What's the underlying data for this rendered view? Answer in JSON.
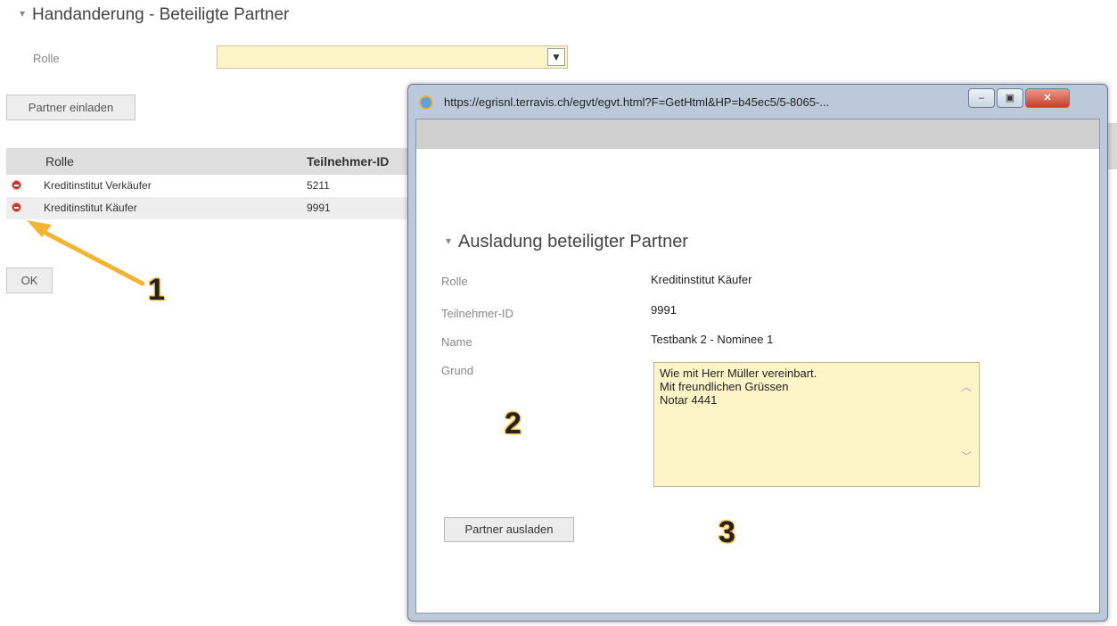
{
  "page": {
    "title": "Handanderung - Beteiligte Partner",
    "rolle_label": "Rolle",
    "rolle_value": "",
    "select_arrow_icon": "chevron-down-icon",
    "invite_button": "Partner einladen",
    "ok_button": "OK"
  },
  "table": {
    "headers": [
      "Rolle",
      "Teilnehmer-ID"
    ],
    "rows": [
      {
        "role": "Kreditinstitut Verkäufer",
        "id": "5211"
      },
      {
        "role": "Kreditinstitut Käufer",
        "id": "9991"
      }
    ],
    "row_icon": "delete-icon"
  },
  "popup": {
    "url": "https://egrisnl.terravis.ch/egvt/egvt.html?F=GetHtml&HP=b45ec5/5-8065-...",
    "min_label": "–",
    "max_label": "▣",
    "close_label": "✕",
    "title": "Ausladung beteiligter Partner",
    "fields": {
      "rolle_label": "Rolle",
      "rolle_value": "Kreditinstitut Käufer",
      "tid_label": "Teilnehmer-ID",
      "tid_value": "9991",
      "name_label": "Name",
      "name_value": "Testbank 2 - Nominee 1",
      "grund_label": "Grund"
    },
    "grund_text": [
      "Wie mit Herr Müller vereinbart.",
      "Mit freundlichen Grüssen",
      "Notar 4441"
    ],
    "button": "Partner ausladen"
  },
  "annotations": [
    "1",
    "2",
    "3"
  ],
  "colors": {
    "field_yellow": "#fdf5c8",
    "arrow_orange": "#f2b431",
    "delete_red": "#c0392b"
  }
}
